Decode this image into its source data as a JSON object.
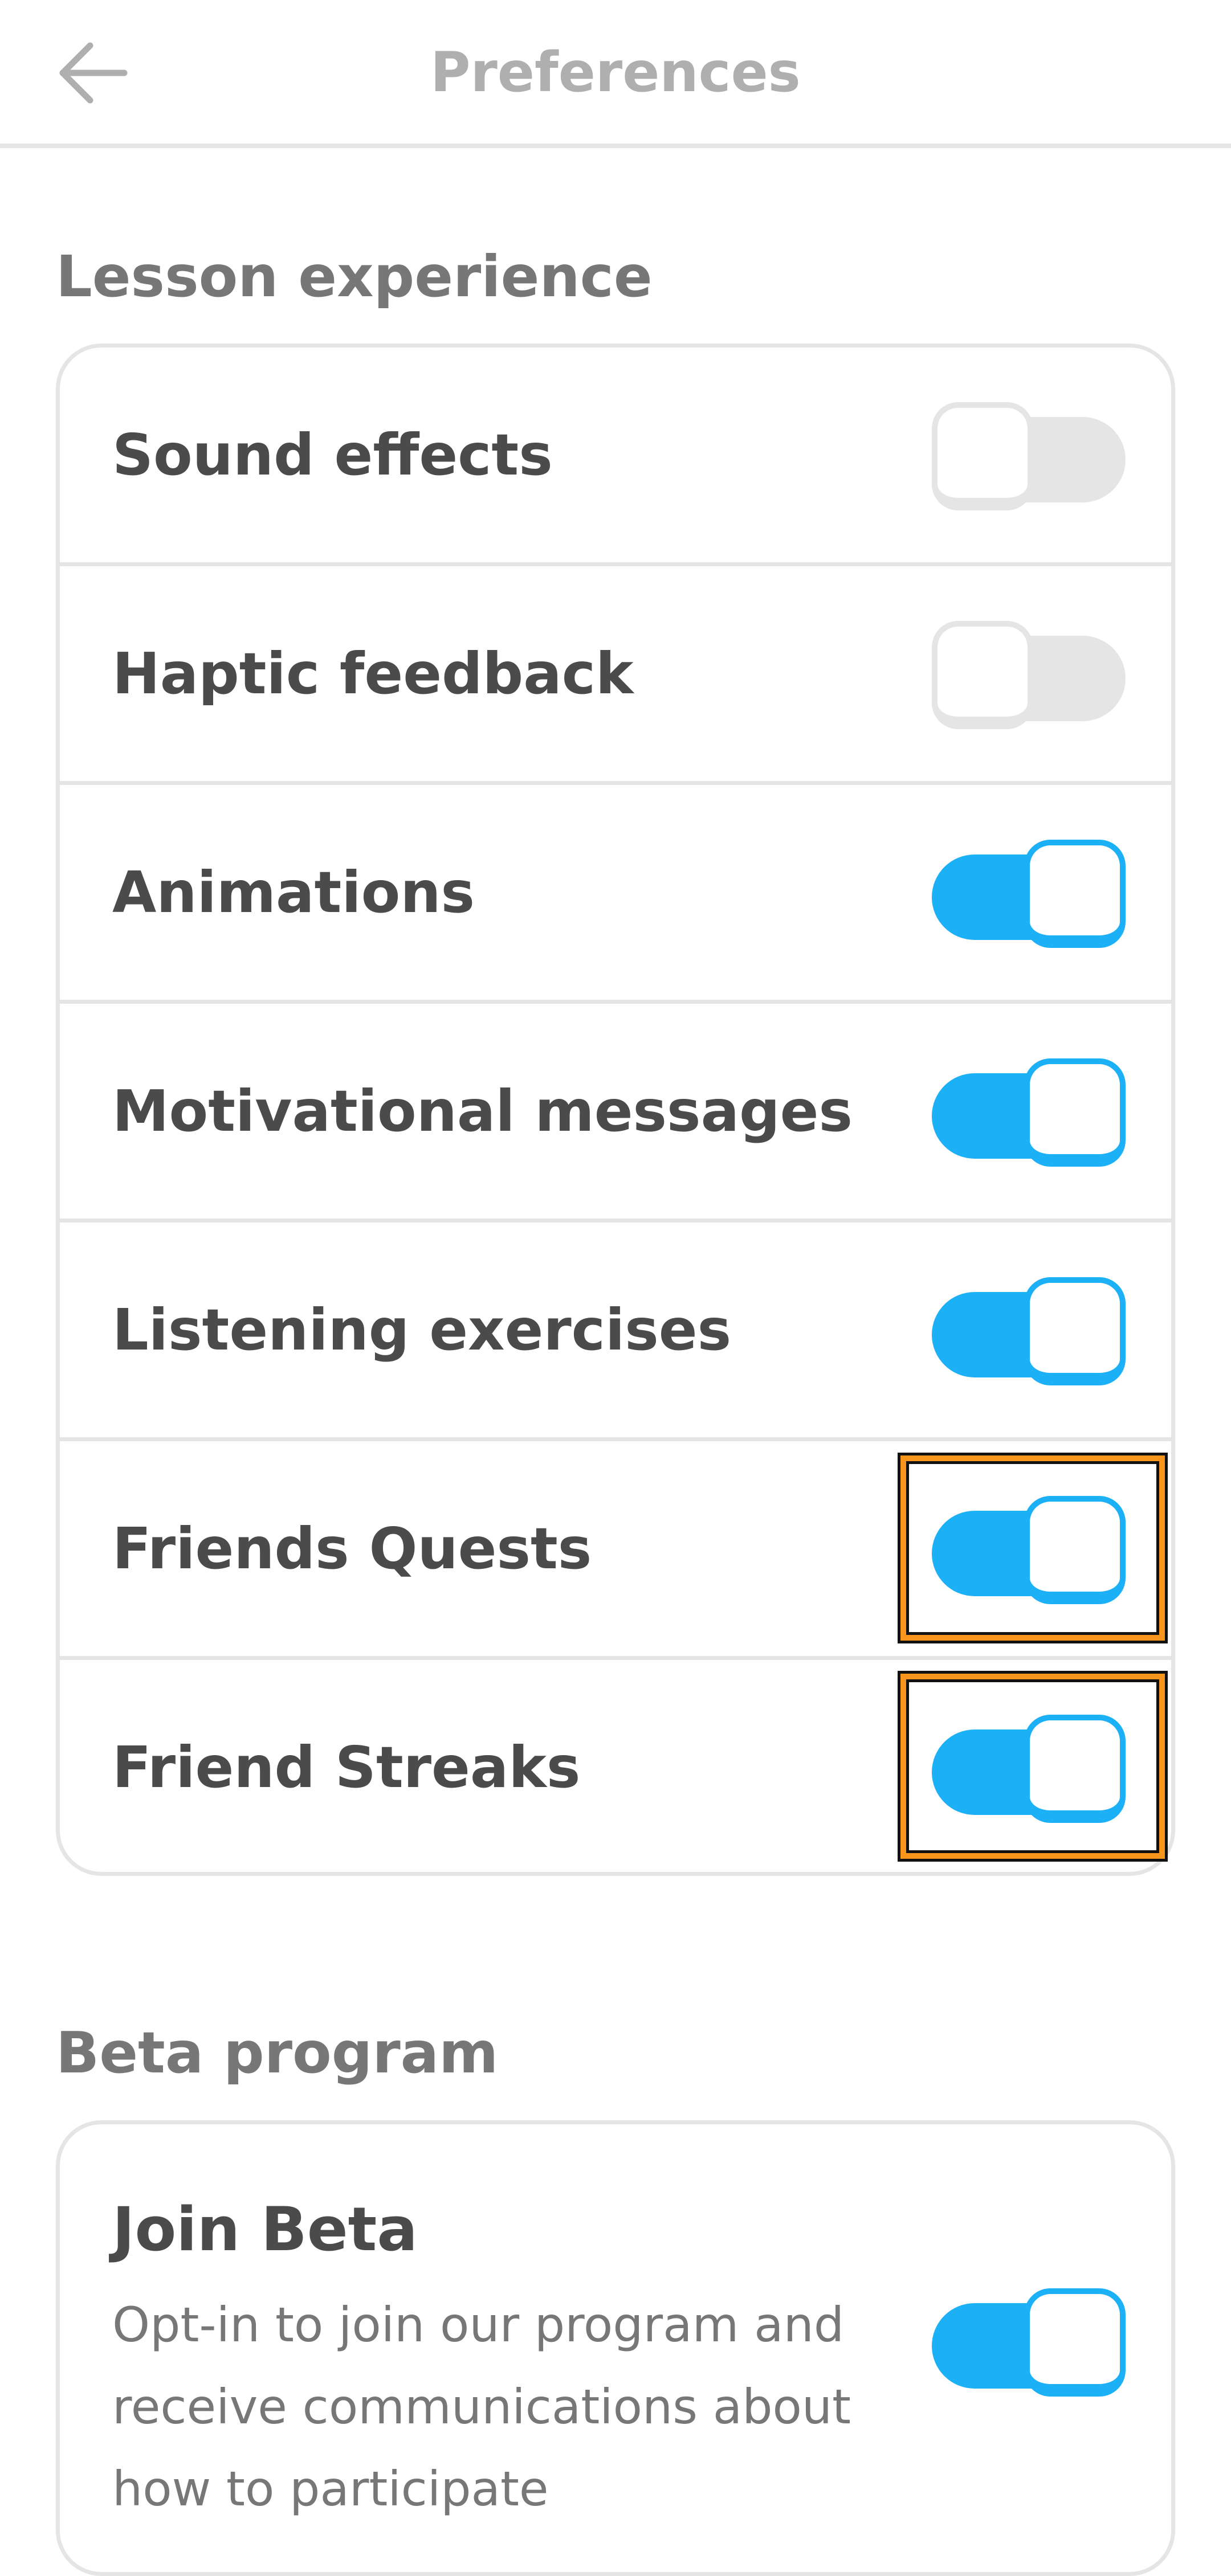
{
  "header": {
    "title": "Preferences",
    "back_icon": "arrow-left-icon"
  },
  "lesson_experience": {
    "section_title": "Lesson experience",
    "items": [
      {
        "label": "Sound effects",
        "enabled": false
      },
      {
        "label": "Haptic feedback",
        "enabled": false
      },
      {
        "label": "Animations",
        "enabled": true
      },
      {
        "label": "Motivational messages",
        "enabled": true
      },
      {
        "label": "Listening exercises",
        "enabled": true
      },
      {
        "label": "Friends Quests",
        "enabled": true
      },
      {
        "label": "Friend Streaks",
        "enabled": true
      }
    ]
  },
  "beta_program": {
    "section_title": "Beta program",
    "join_title": "Join Beta",
    "join_description": "Opt-in to join our program and receive communications about how to participate",
    "enabled": true
  },
  "colors": {
    "accent": "#1cb0f6",
    "toggle_off": "#e5e5e5",
    "highlight": "#f7951d",
    "text_primary": "#4b4b4b",
    "text_secondary": "#777777",
    "title_muted": "#afafaf"
  }
}
